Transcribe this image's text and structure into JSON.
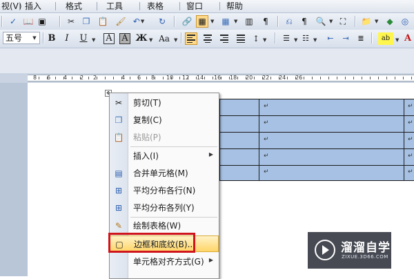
{
  "menubar": {
    "items": [
      "视(V)",
      "插入",
      "格式",
      "工具",
      "表格",
      "窗口",
      "帮助"
    ]
  },
  "toolbar": {
    "font_size_value": "五号",
    "bold_label": "B",
    "italic_label": "I",
    "underline_label": "U",
    "border_char_label": "A",
    "shade_char_label": "A",
    "font_scale_label": "Aa",
    "highlight_label": "ab"
  },
  "ruler": {
    "numbers": [
      "8",
      "6",
      "4",
      "2",
      "2",
      "4",
      "6",
      "8",
      "10",
      "12",
      "14",
      "16",
      "18",
      "20",
      "22",
      "24",
      "26"
    ]
  },
  "table": {
    "cell_mark": "↵"
  },
  "context_menu": {
    "items": [
      {
        "label": "剪切(T)",
        "icon": "scissors-icon",
        "enabled": true
      },
      {
        "label": "复制(C)",
        "icon": "copy-icon",
        "enabled": true
      },
      {
        "label": "粘贴(P)",
        "icon": "paste-icon",
        "enabled": false
      },
      {
        "label": "插入(I)",
        "icon": "",
        "enabled": true,
        "submenu": true
      },
      {
        "label": "合并单元格(M)",
        "icon": "merge-cells-icon",
        "enabled": true
      },
      {
        "label": "平均分布各行(N)",
        "icon": "distribute-rows-icon",
        "enabled": true
      },
      {
        "label": "平均分布各列(Y)",
        "icon": "distribute-columns-icon",
        "enabled": true
      },
      {
        "label": "绘制表格(W)",
        "icon": "draw-table-icon",
        "enabled": true
      },
      {
        "label": "边框和底纹(B)...",
        "icon": "borders-shading-icon",
        "enabled": true,
        "highlighted": true
      },
      {
        "label": "单元格对齐方式(G)",
        "icon": "",
        "enabled": true,
        "submenu": true
      }
    ]
  },
  "watermark": {
    "brand": "溜溜自学",
    "url": "ZIXUE.3D66.COM"
  },
  "colors": {
    "table_fill": "#a6c1e3",
    "menu_highlight": "#ffd567",
    "annotation_red": "#d0141c"
  }
}
